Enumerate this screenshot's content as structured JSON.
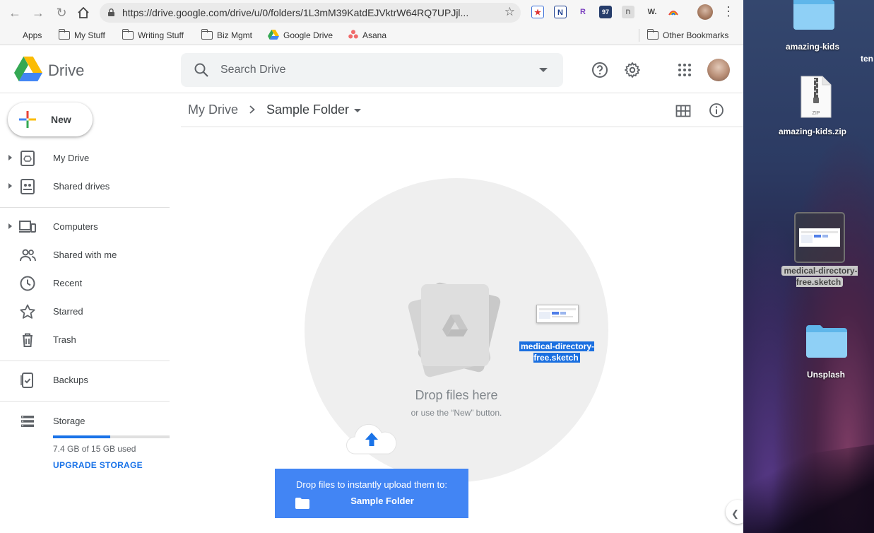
{
  "browser": {
    "url": "https://drive.google.com/drive/u/0/folders/1L3mM39KatdEJVktrW64RQ7UPJjl...",
    "extensions": [
      "N",
      "R",
      "97",
      "W."
    ],
    "bookmarks": [
      {
        "label": "Apps",
        "icon": "apps-grid-icon"
      },
      {
        "label": "My Stuff",
        "icon": "folder-icon"
      },
      {
        "label": "Writing Stuff",
        "icon": "folder-icon"
      },
      {
        "label": "Biz Mgmt",
        "icon": "folder-icon"
      },
      {
        "label": "Google Drive",
        "icon": "google-drive-icon"
      },
      {
        "label": "Asana",
        "icon": "asana-icon"
      }
    ],
    "other_bookmarks": "Other Bookmarks"
  },
  "drive": {
    "app_name": "Drive",
    "search_placeholder": "Search Drive",
    "new_button": "New",
    "nav": [
      {
        "label": "My Drive",
        "icon": "my-drive-icon",
        "expandable": true
      },
      {
        "label": "Shared drives",
        "icon": "shared-drives-icon",
        "expandable": true
      },
      {
        "label": "Computers",
        "icon": "computers-icon",
        "expandable": true
      },
      {
        "label": "Shared with me",
        "icon": "shared-with-me-icon",
        "expandable": false
      },
      {
        "label": "Recent",
        "icon": "clock-icon",
        "expandable": false
      },
      {
        "label": "Starred",
        "icon": "star-icon",
        "expandable": false
      },
      {
        "label": "Trash",
        "icon": "trash-icon",
        "expandable": false
      },
      {
        "label": "Backups",
        "icon": "backups-icon",
        "expandable": false
      },
      {
        "label": "Storage",
        "icon": "storage-icon",
        "expandable": false
      }
    ],
    "storage": {
      "used_fraction": 0.493,
      "text": "7.4 GB of 15 GB used",
      "upgrade": "UPGRADE STORAGE"
    },
    "breadcrumb": {
      "root": "My Drive",
      "current": "Sample Folder"
    },
    "drop_zone": {
      "title": "Drop files here",
      "subtitle": "or use the “New” button."
    },
    "dragged_file": "medical-directory-free.sketch",
    "upload_toast": {
      "line1": "Drop files to instantly upload them to:",
      "folder": "Sample Folder"
    }
  },
  "desktop": {
    "items": [
      {
        "label": "amazing-kids",
        "icon": "folder-icon"
      },
      {
        "label": "amazing-kids.zip",
        "icon": "zip-file-icon"
      },
      {
        "label": "medical-directory-free.sketch",
        "icon": "sketch-file-icon",
        "selected": true
      },
      {
        "label": "Unsplash",
        "icon": "folder-icon"
      }
    ],
    "cut_off_label": "ten"
  },
  "colors": {
    "accent": "#1a73e8",
    "toast": "#4285f4",
    "drop_circle": "#efefef"
  }
}
